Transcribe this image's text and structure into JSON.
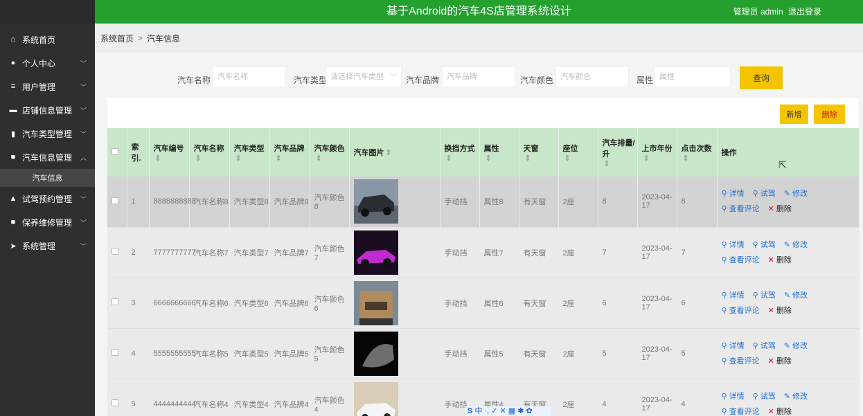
{
  "app": {
    "title": "基于Android的汽车4S店管理系统设计",
    "user": "管理员 admin",
    "logout": "退出登录"
  },
  "sidebar": {
    "items": [
      {
        "label": "系统首页",
        "icon": "home-icon",
        "glyph": "⌂"
      },
      {
        "label": "个人中心",
        "icon": "user-icon",
        "glyph": "●"
      },
      {
        "label": "用户管理",
        "icon": "sliders-icon",
        "glyph": "≡"
      },
      {
        "label": "店铺信息管理",
        "icon": "store-icon",
        "glyph": "▬"
      },
      {
        "label": "汽车类型管理",
        "icon": "bar-chart-icon",
        "glyph": "▮"
      },
      {
        "label": "汽车信息管理",
        "icon": "file-icon",
        "glyph": "■"
      },
      {
        "label": "试驾预约管理",
        "icon": "car-icon",
        "glyph": "▲"
      },
      {
        "label": "保养维修管理",
        "icon": "wrench-icon",
        "glyph": "■"
      },
      {
        "label": "系统管理",
        "icon": "send-icon",
        "glyph": "➤"
      }
    ],
    "submenu": {
      "label": "汽车信息"
    }
  },
  "breadcrumb": {
    "home": "系统首页",
    "separator": ">",
    "current": "汽车信息"
  },
  "search": {
    "name_label": "汽车名称",
    "name_placeholder": "汽车名称",
    "type_label": "汽车类型",
    "type_placeholder": "请选择汽车类型",
    "brand_label": "汽车品牌",
    "brand_placeholder": "汽车品牌",
    "color_label": "汽车颜色",
    "color_placeholder": "汽车颜色",
    "attr_label": "属性",
    "attr_placeholder": "属性",
    "query_button": "查询"
  },
  "toolbar": {
    "add_label": "新增",
    "delete_label": "删除"
  },
  "table": {
    "headers": {
      "index": "索引.",
      "car_no": "汽车编号",
      "car_name": "汽车名称",
      "car_type": "汽车类型",
      "car_brand": "汽车品牌",
      "car_color": "汽车颜色",
      "car_image": "汽车图片",
      "gearbox": "换挡方式",
      "attr": "属性",
      "sunroof": "天窗",
      "seats": "座位",
      "displacement": "汽车排量/升",
      "year": "上市年份",
      "clicks": "点击次数",
      "actions": "操作"
    },
    "sort_glyph": "⇕",
    "actions": {
      "detail": "详情",
      "test_drive": "试驾",
      "edit": "修改",
      "reviews": "查看评论",
      "delete": "删除"
    },
    "rows": [
      {
        "index": "1",
        "car_no": "8888888888",
        "car_name": "汽车名称8",
        "car_type": "汽车类型8",
        "car_brand": "汽车品牌8",
        "car_color": "汽车颜色8",
        "gearbox": "手动挡",
        "attr": "属性8",
        "sunroof": "有天窗",
        "seats": "2座",
        "displacement": "8",
        "year": "2023-04-17",
        "clicks": "8"
      },
      {
        "index": "2",
        "car_no": "7777777777",
        "car_name": "汽车名称7",
        "car_type": "汽车类型7",
        "car_brand": "汽车品牌7",
        "car_color": "汽车颜色7",
        "gearbox": "手动挡",
        "attr": "属性7",
        "sunroof": "有天窗",
        "seats": "2座",
        "displacement": "7",
        "year": "2023-04-17",
        "clicks": "7"
      },
      {
        "index": "3",
        "car_no": "6666666666",
        "car_name": "汽车名称6",
        "car_type": "汽车类型6",
        "car_brand": "汽车品牌6",
        "car_color": "汽车颜色6",
        "gearbox": "手动挡",
        "attr": "属性6",
        "sunroof": "有天窗",
        "seats": "2座",
        "displacement": "6",
        "year": "2023-04-17",
        "clicks": "6"
      },
      {
        "index": "4",
        "car_no": "5555555555",
        "car_name": "汽车名称5",
        "car_type": "汽车类型5",
        "car_brand": "汽车品牌5",
        "car_color": "汽车颜色5",
        "gearbox": "手动挡",
        "attr": "属性5",
        "sunroof": "有天窗",
        "seats": "2座",
        "displacement": "5",
        "year": "2023-04-17",
        "clicks": "5"
      },
      {
        "index": "5",
        "car_no": "4444444444",
        "car_name": "汽车名称4",
        "car_type": "汽车类型4",
        "car_brand": "汽车品牌4",
        "car_color": "汽车颜色4",
        "gearbox": "手动挡",
        "attr": "属性4",
        "sunroof": "有天窗",
        "seats": "2座",
        "displacement": "4",
        "year": "2023-04-17",
        "clicks": "4"
      }
    ]
  },
  "colors": {
    "header_green": "#24a02f",
    "sidebar_dark": "#2f2f2f",
    "button_yellow": "#f5c400",
    "table_head": "#c8e7c8",
    "link_blue": "#1e6fd6",
    "danger_red": "#d0102c"
  },
  "ime_bar": {
    "text": "中 ·, ✓ ✕ ▦ ✱ ✿"
  }
}
